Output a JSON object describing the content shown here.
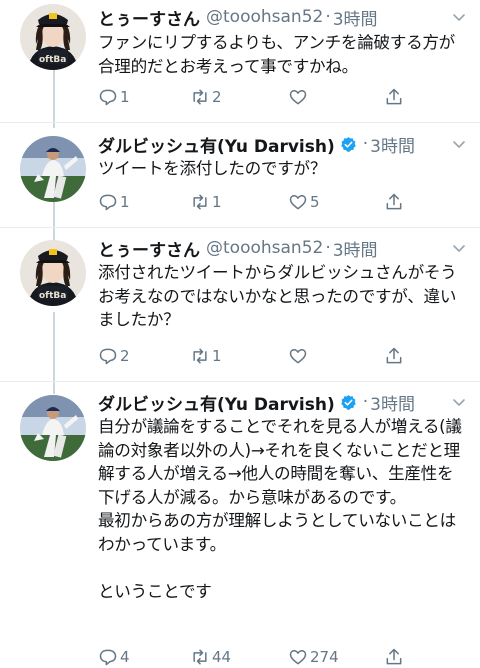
{
  "colors": {
    "text": "#14171a",
    "muted": "#657786",
    "verified": "#1da1f2",
    "thread_line": "#ccd6dd",
    "divider": "#e6ecf0"
  },
  "icons": {
    "reply": "reply-icon",
    "retweet": "retweet-icon",
    "like": "heart-icon",
    "share": "share-icon",
    "more": "chevron-down-icon",
    "verified": "verified-badge-icon"
  },
  "tweets": [
    {
      "name": "とぅーすさん",
      "handle": "@tooohsan52",
      "sep": "·",
      "time": "3時間",
      "verified": false,
      "text": "ファンにリプするよりも、アンチを論破する方が合理的だとお考えって事ですかね。",
      "replies": "1",
      "retweets": "2",
      "likes": "",
      "avatar_logo": "oftBa"
    },
    {
      "name": "ダルビッシュ有(Yu Darvish)",
      "handle": "",
      "sep": "·",
      "time": "3時間",
      "verified": true,
      "text": "ツイートを添付したのですが？",
      "replies": "1",
      "retweets": "1",
      "likes": "5"
    },
    {
      "name": "とぅーすさん",
      "handle": "@tooohsan52",
      "sep": "·",
      "time": "3時間",
      "verified": false,
      "text": "添付されたツイートからダルビッシュさんがそうお考えなのではないかなと思ったのですが、違いましたか？",
      "replies": "2",
      "retweets": "1",
      "likes": "",
      "avatar_logo": "oftBa"
    },
    {
      "name": "ダルビッシュ有(Yu Darvish)",
      "handle": "",
      "sep": "·",
      "time": "3時間",
      "verified": true,
      "text": "自分が議論をすることでそれを見る人が増える(議論の対象者以外の人)→それを良くないことだと理解する人が増える→他人の時間を奪い、生産性を下げる人が減る。から意味があるのです。\n最初からあの方が理解しようとしていないことはわかっています。\n\nということです",
      "replies": "4",
      "retweets": "44",
      "likes": "274"
    }
  ]
}
